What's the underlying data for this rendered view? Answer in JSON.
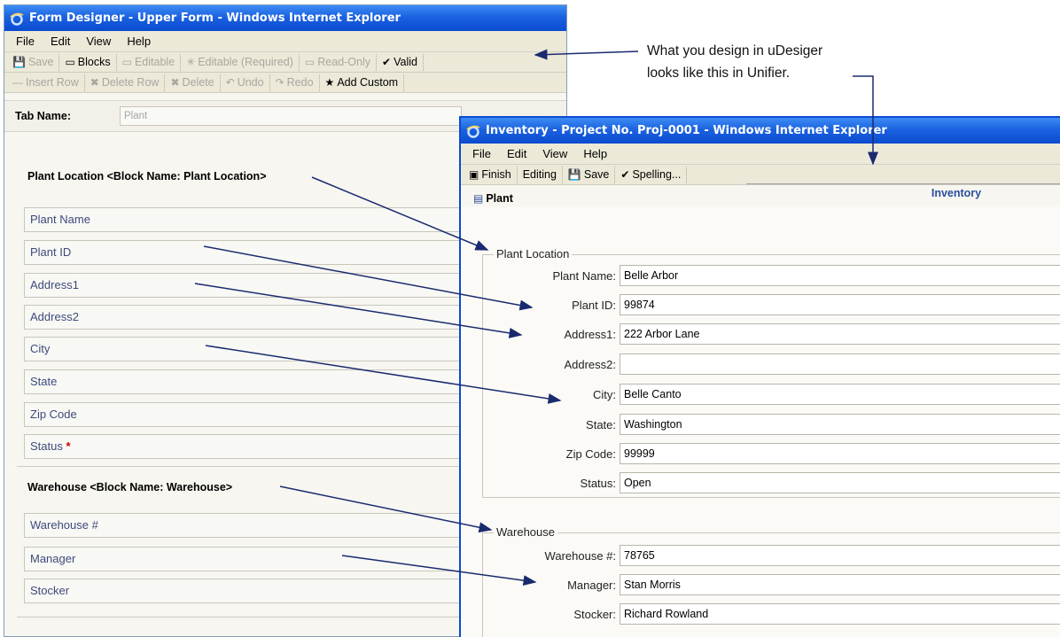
{
  "designer": {
    "title": "Form Designer - Upper Form - Windows Internet Explorer",
    "menu": [
      "File",
      "Edit",
      "View",
      "Help"
    ],
    "toolbar1": [
      {
        "label": "Save",
        "icon": "save-icon",
        "glyph": "💾",
        "disabled": true
      },
      {
        "label": "Blocks",
        "icon": "blocks-icon",
        "glyph": "▭",
        "disabled": false
      },
      {
        "label": "Editable",
        "icon": "editable-icon",
        "glyph": "▭",
        "disabled": true
      },
      {
        "label": "Editable (Required)",
        "icon": "editable-required-icon",
        "glyph": "✳",
        "disabled": true
      },
      {
        "label": "Read-Only",
        "icon": "read-only-icon",
        "glyph": "▭",
        "disabled": true
      },
      {
        "label": "Valid",
        "icon": "validate-icon",
        "glyph": "✔",
        "disabled": false
      }
    ],
    "toolbar2": [
      {
        "label": "Insert Row",
        "icon": "insert-row-icon",
        "glyph": "—",
        "disabled": true
      },
      {
        "label": "Delete Row",
        "icon": "delete-row-icon",
        "glyph": "✖",
        "disabled": true
      },
      {
        "label": "Delete",
        "icon": "delete-icon",
        "glyph": "✖",
        "disabled": true
      },
      {
        "label": "Undo",
        "icon": "undo-icon",
        "glyph": "↶",
        "disabled": true
      },
      {
        "label": "Redo",
        "icon": "redo-icon",
        "glyph": "↷",
        "disabled": true
      },
      {
        "label": "Add Custom",
        "icon": "add-custom-icon",
        "glyph": "★",
        "disabled": false
      }
    ],
    "tab_name_label": "Tab Name:",
    "tab_name_value": "Plant",
    "block1_title": "Plant Location <Block Name: Plant Location>",
    "block1_fields": [
      "Plant Name",
      "Plant ID",
      "Address1",
      "Address2",
      "City",
      "State",
      "Zip Code",
      "Status"
    ],
    "required_marker": "*",
    "block2_title": "Warehouse <Block Name: Warehouse>",
    "block2_fields": [
      "Warehouse #",
      "Manager",
      "Stocker"
    ]
  },
  "unifier": {
    "title": "Inventory - Project No. Proj-0001 - Windows Internet Explorer",
    "menu": [
      "File",
      "Edit",
      "View",
      "Help"
    ],
    "toolbar": [
      {
        "label": "Finish",
        "icon": "finish-icon",
        "glyph": "▣"
      },
      {
        "label": "Editing",
        "icon": "",
        "glyph": ""
      },
      {
        "label": "Save",
        "icon": "save-icon",
        "glyph": "💾"
      },
      {
        "label": "Spelling...",
        "icon": "spelling-icon",
        "glyph": "✔"
      }
    ],
    "tab_plant": "Plant",
    "tab_inventory": "Inventory",
    "group1_legend": "Plant Location",
    "group1_rows": [
      {
        "label": "Plant Name:",
        "value": "Belle Arbor"
      },
      {
        "label": "Plant ID:",
        "value": "99874"
      },
      {
        "label": "Address1:",
        "value": "222 Arbor Lane"
      },
      {
        "label": "Address2:",
        "value": ""
      },
      {
        "label": "City:",
        "value": "Belle Canto"
      },
      {
        "label": "State:",
        "value": "Washington"
      },
      {
        "label": "Zip Code:",
        "value": "99999"
      },
      {
        "label": "Status:",
        "value": "Open"
      }
    ],
    "group2_legend": "Warehouse",
    "group2_rows": [
      {
        "label": "Warehouse #:",
        "value": "78765"
      },
      {
        "label": "Manager:",
        "value": "Stan Morris"
      },
      {
        "label": "Stocker:",
        "value": "Richard Rowland"
      }
    ]
  },
  "annotation": {
    "line1": "What you design in uDesiger",
    "line2": "looks like this in Unifier."
  },
  "colors": {
    "titlebar": "#1b62e0",
    "toolbar_bg": "#ece9d8",
    "required": "#cc0000",
    "arrow": "#1a2a6e"
  }
}
